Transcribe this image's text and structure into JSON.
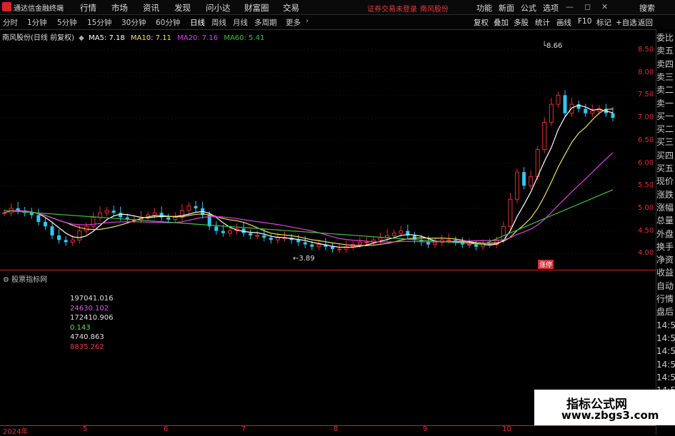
{
  "app": {
    "title": "通达信金融终端"
  },
  "menu": [
    "行情",
    "市场",
    "资讯",
    "发现",
    "问小达",
    "财富圈",
    "交易"
  ],
  "notice": "证券交易未登录",
  "stock_name_top": "南风股份",
  "right_menu": [
    "功能",
    "新面",
    "公式",
    "选项"
  ],
  "search_label": "搜索",
  "period_tabs": [
    "分时",
    "1分钟",
    "5分钟",
    "15分钟",
    "30分钟",
    "60分钟",
    "日线",
    "周线",
    "月线",
    "多周期",
    "更多"
  ],
  "active_period": "日线",
  "tool_buttons": [
    "复权",
    "叠加",
    "多股",
    "统计",
    "画线",
    "F10",
    "标记",
    "+自选",
    "返回"
  ],
  "legend": {
    "title": "南风股份(日线 前复权)",
    "ma5": "MA5: 7.18",
    "ma10": "MA10: 7.11",
    "ma20": "MA20: 7.16",
    "ma60": "MA60: 5.41"
  },
  "colors": {
    "ma5": "#ffffff",
    "ma10": "#f0e060",
    "ma20": "#e040e0",
    "ma60": "#40c040",
    "up": "#e03030",
    "down": "#30c8f0"
  },
  "high_annot": "8.66",
  "low_annot": "3.89",
  "tag_label": "涨停",
  "y_ticks": [
    "8.50",
    "8.00",
    "7.50",
    "7.00",
    "6.50",
    "6.00",
    "5.50",
    "5.00",
    "4.50",
    "4.00"
  ],
  "right_panel": [
    "委比",
    "卖五",
    "卖四",
    "卖三",
    "卖二",
    "卖一",
    "买一",
    "买二",
    "买三",
    "买四",
    "买五",
    "现价",
    "涨跌",
    "涨幅",
    "总量",
    "外盘",
    "换手",
    "净资",
    "收益",
    "自动",
    "行情",
    "盘后",
    "14:5",
    "14:5",
    "14:5",
    "14:5",
    "14:5",
    "14:5"
  ],
  "indicator_head": "股票指标网",
  "indicator_values": [
    {
      "v": "197041.016",
      "c": "#e0e0e0"
    },
    {
      "v": "24630.102",
      "c": "#d060e0"
    },
    {
      "v": "172410.906",
      "c": "#e0e0e0"
    },
    {
      "v": "0.143",
      "c": "#60e060"
    },
    {
      "v": "4740.863",
      "c": "#e0e0e0"
    },
    {
      "v": "8835.262",
      "c": "#e04040"
    }
  ],
  "x_ticks": [
    "2024年",
    "5",
    "6",
    "7",
    "8",
    "9",
    "10"
  ],
  "watermark": {
    "line1": "指标公式网",
    "line2": "www.zbgs3.com"
  },
  "chart_data": {
    "type": "candlestick",
    "y_range": [
      3.7,
      8.75
    ],
    "close_series": [
      4.9,
      5.0,
      4.95,
      4.9,
      4.85,
      4.7,
      4.6,
      4.4,
      4.3,
      4.25,
      4.3,
      4.5,
      4.6,
      4.8,
      4.9,
      4.95,
      4.9,
      4.8,
      4.75,
      4.75,
      4.8,
      4.85,
      4.9,
      4.8,
      4.75,
      4.8,
      4.95,
      5.05,
      5.0,
      4.85,
      4.6,
      4.5,
      4.45,
      4.5,
      4.55,
      4.45,
      4.4,
      4.4,
      4.35,
      4.3,
      4.35,
      4.35,
      4.3,
      4.25,
      4.2,
      4.15,
      4.2,
      4.15,
      4.1,
      4.1,
      4.15,
      4.2,
      4.25,
      4.25,
      4.3,
      4.35,
      4.4,
      4.45,
      4.5,
      4.4,
      4.3,
      4.25,
      4.2,
      4.25,
      4.3,
      4.3,
      4.25,
      4.2,
      4.2,
      4.15,
      4.2,
      4.2,
      4.3,
      4.6,
      5.2,
      5.8,
      5.5,
      5.7,
      6.3,
      6.9,
      7.3,
      7.5,
      7.1,
      7.3,
      7.2,
      7.1,
      7.15,
      7.2,
      7.1,
      7.0
    ],
    "ma60_start": 4.95,
    "ma60_end": 5.41
  }
}
